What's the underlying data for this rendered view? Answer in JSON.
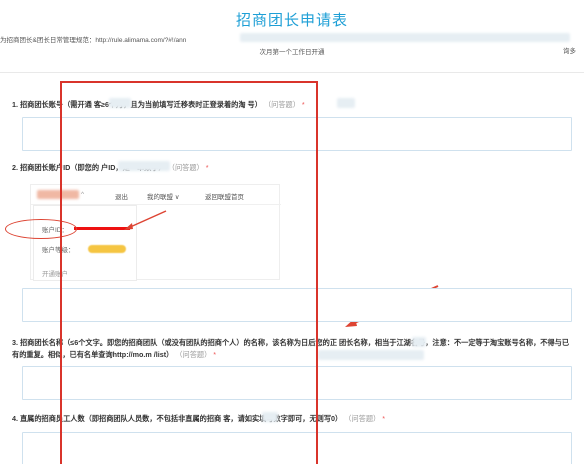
{
  "header": {
    "title": "招商团长申请表",
    "notice": "为招商团长&团长日常管理规范：http://rule.alimama.com/?#!/ann",
    "subnotice": "次月第一个工作日开通",
    "right_fragment": "询多"
  },
  "questions": [
    {
      "label": "1. 招商团长账号（需开通 客≥6个月，且为当前填写迁移表时正登录着的淘 号）",
      "hint": "（问答题）",
      "req": "*"
    },
    {
      "label": "2. 招商团长账户ID（即您的 户ID，是一串数字）",
      "hint": "（问答题）",
      "req": "*"
    },
    {
      "label": "3. 招商团长名称（≤6个文字。即您的招商团队（或没有团队的招商个人）的名称，该名称为日后您的正 团长名称，相当于江湖名号，注意：不一定等于淘宝账号名称，不得与已有的重复。相似，已有名单查询http://mo.m /list）",
      "hint": "（问答题）",
      "req": "*"
    },
    {
      "label": "4. 直属的招商员工人数（即招商团队人员数，不包括非直属的招商 客，请如实填写数字即可，无则写0）",
      "hint": "（问答题）",
      "req": "*"
    }
  ],
  "screenshot": {
    "menu": [
      "退出",
      "我的联盟 ∨",
      "返回联盟首页"
    ],
    "account_label": "账户ID：",
    "level_label": "账户等级：",
    "third_label": "开通账户"
  },
  "colors": {
    "title": "#1e9fd6",
    "annotation_red": "#d9342b"
  }
}
